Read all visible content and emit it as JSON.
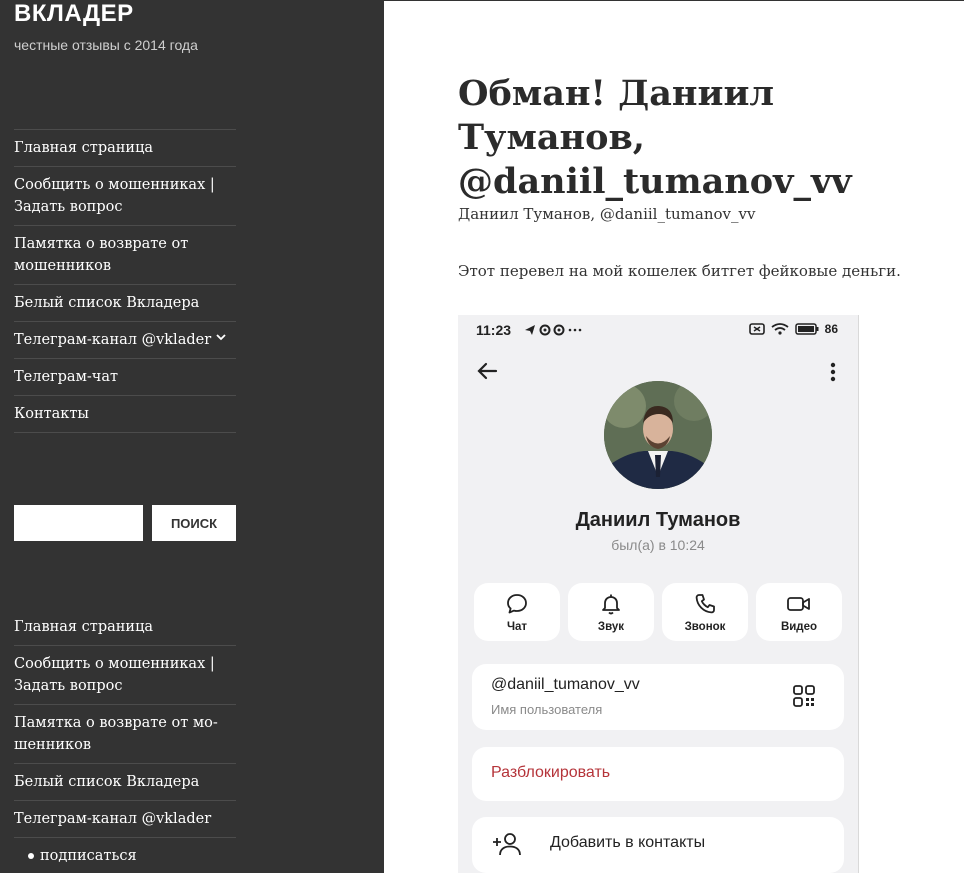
{
  "site": {
    "title": "ВКЛАДЕР",
    "description": "честные отзывы с 2014 года"
  },
  "sidebar": {
    "menu_top": [
      {
        "label": "Главная страница"
      },
      {
        "label": "Сообщить о мошенниках | Задать вопрос"
      },
      {
        "label": "Памятка о возврате от мошенников"
      },
      {
        "label": "Белый список Вкладера"
      },
      {
        "label": "Телеграм-канал @vklader"
      },
      {
        "label": "Телеграм-чат"
      },
      {
        "label": "Контакты"
      }
    ],
    "search": {
      "placeholder": "",
      "button_label": "ПОИСК"
    },
    "menu_bottom": [
      {
        "label": "Главная страница"
      },
      {
        "label": "Сообщить о мошенниках | Задать вопрос"
      },
      {
        "label": "Памятка о возврате от мо-шенников"
      },
      {
        "label": "Белый список Вкладера"
      },
      {
        "label": "Телеграм-канал @vklader"
      },
      {
        "label": "подписаться"
      }
    ]
  },
  "post": {
    "title": "Обман! Даниил Туманов, @daniil_tumanov_vv",
    "paragraph_1": "Даниил Туманов, @daniil_tumanov_vv",
    "paragraph_2": "Этот перевел на мой кошелек битгет фейковые деньги."
  },
  "screenshot": {
    "status_time": "11:23",
    "battery": "86",
    "profile_name": "Даниил Туманов",
    "last_seen": "был(а) в 10:24",
    "actions": [
      {
        "label": "Чат",
        "icon": "chat-icon"
      },
      {
        "label": "Звук",
        "icon": "bell-icon"
      },
      {
        "label": "Звонок",
        "icon": "phone-icon"
      },
      {
        "label": "Видео",
        "icon": "video-icon"
      }
    ],
    "username": "@daniil_tumanov_vv",
    "username_label": "Имя пользователя",
    "unblock_label": "Разблокировать",
    "add_contact_label": "Добавить в контакты"
  },
  "colors": {
    "sidebar_bg": "#333333",
    "unblock_red": "#b5343a"
  }
}
